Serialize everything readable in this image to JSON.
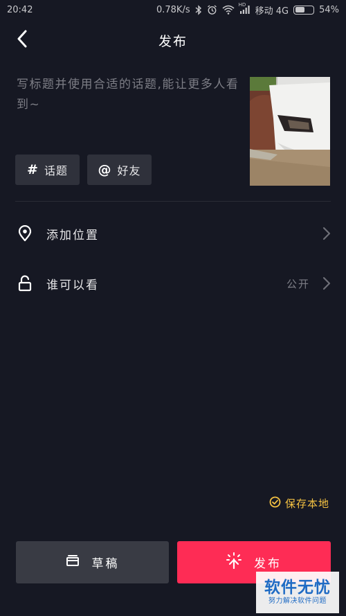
{
  "status_bar": {
    "time": "20:42",
    "network_speed": "0.78K/s",
    "hd_badge": "HD",
    "carrier": "移动 4G",
    "battery_percent": "54%",
    "battery_level": 0.54
  },
  "header": {
    "title": "发布",
    "back_icon": "chevron-left-icon"
  },
  "caption": {
    "placeholder": "写标题并使用合适的话题,能让更多人看到~"
  },
  "chips": {
    "topic_symbol": "#",
    "topic_label": "话题",
    "friend_symbol": "@",
    "friend_label": "好友"
  },
  "options": {
    "location_label": "添加位置",
    "location_icon": "location-pin-icon",
    "privacy_label": "谁可以看",
    "privacy_value": "公开",
    "privacy_icon": "unlock-icon"
  },
  "save_local": {
    "label": "保存本地",
    "checked": true
  },
  "buttons": {
    "draft_label": "草稿",
    "publish_label": "发布"
  },
  "watermark": {
    "title": "软件无忧",
    "subtitle": "努力解决软件问题"
  },
  "colors": {
    "background": "#161823",
    "accent": "#fe2c55",
    "save_local": "#f5c242",
    "chip_bg": "#2f313b",
    "draft_bg": "#393b44"
  }
}
